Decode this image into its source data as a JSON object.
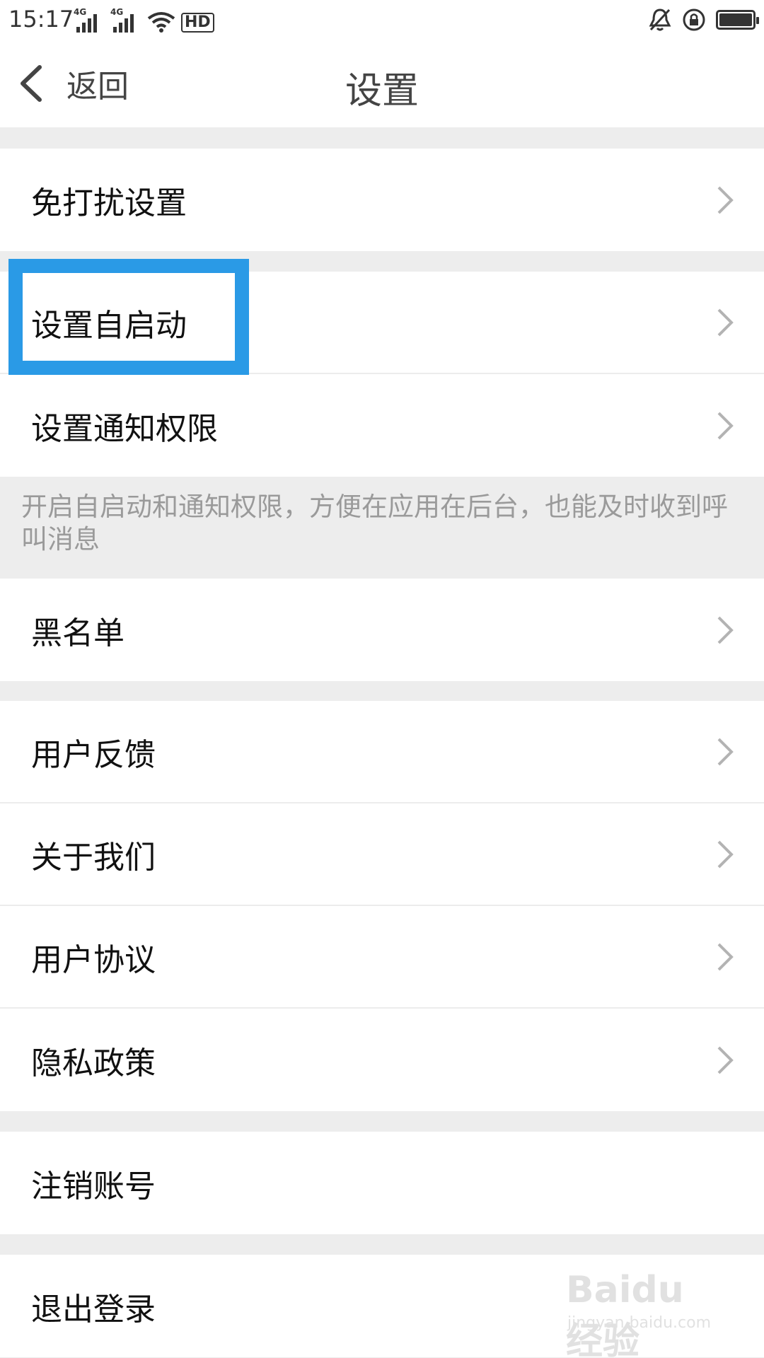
{
  "status_bar": {
    "time": "15:17",
    "net1": "4G",
    "net2": "4G",
    "hd": "HD"
  },
  "header": {
    "back_label": "返回",
    "title": "设置"
  },
  "groups": {
    "g1": [
      "免打扰设置"
    ],
    "g2": [
      "设置自启动",
      "设置通知权限"
    ],
    "g3": [
      "黑名单"
    ],
    "g4": [
      "用户反馈",
      "关于我们",
      "用户协议",
      "隐私政策"
    ],
    "g5": [
      "注销账号"
    ],
    "g6": [
      "退出登录"
    ]
  },
  "note": "开启自启动和通知权限，方便在应用在后台，也能及时收到呼叫消息",
  "watermark": {
    "logo": "Baidu 经验",
    "url": "jingyan.baidu.com"
  },
  "colors": {
    "highlight": "#2a9ae6",
    "background": "#ededed",
    "row_bg": "#ffffff"
  }
}
